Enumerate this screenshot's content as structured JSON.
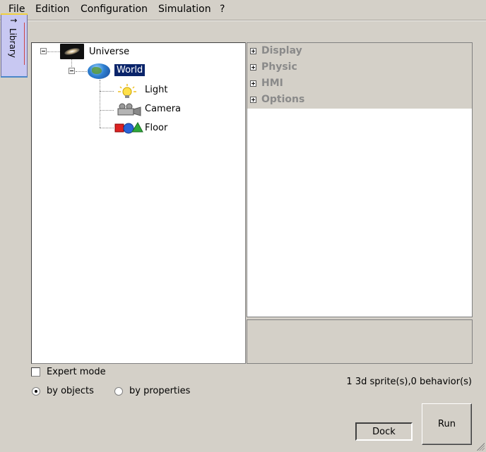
{
  "menu": {
    "items": [
      "File",
      "Edition",
      "Configuration",
      "Simulation",
      "?"
    ]
  },
  "library_tab": {
    "label": "Library",
    "arrow": "↑"
  },
  "tree": {
    "root": "Universe",
    "world": "World",
    "children": [
      "Light",
      "Camera",
      "Floor"
    ]
  },
  "properties": {
    "sections": [
      "Display",
      "Physic",
      "HMI",
      "Options"
    ]
  },
  "controls": {
    "expert_mode_label": "Expert mode",
    "expert_mode_checked": false,
    "radio_by_objects": "by objects",
    "radio_by_properties": "by properties",
    "selected_view": "by objects"
  },
  "status_text": "1 3d sprite(s),0 behavior(s)",
  "buttons": {
    "dock": "Dock",
    "run": "Run"
  },
  "colors": {
    "window_bg": "#d4d0c8",
    "selection": "#0a246a",
    "library_tab": "#c8c8f2"
  },
  "icons": {
    "universe": "galaxy-icon",
    "world": "globe-icon",
    "light": "lightbulb-icon",
    "camera": "camera-icon",
    "floor": "shapes-icon"
  }
}
